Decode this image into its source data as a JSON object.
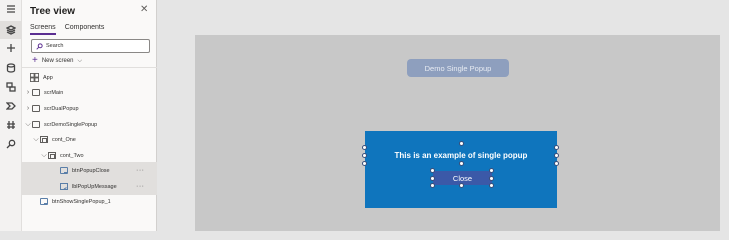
{
  "panel": {
    "title": "Tree view",
    "tabs": [
      {
        "label": "Screens",
        "active": true
      },
      {
        "label": "Components",
        "active": false
      }
    ],
    "search_placeholder": "Search",
    "new_screen_label": "New screen"
  },
  "tree": {
    "app": "App",
    "scrMain": "scrMain",
    "scrDualPopup": "scrDualPopup",
    "scrDemoSinglePopup": "scrDemoSinglePopup",
    "cont_One": "cont_One",
    "cont_Two": "cont_Two",
    "btnPopupClose": "btnPopupClose",
    "lblPopUpMessage": "lblPopUpMessage",
    "btnShowSinglePopup_1": "btnShowSinglePopup_1",
    "more": "···"
  },
  "canvas": {
    "demo_button_label": "Demo Single Popup",
    "popup_message": "This is an example of single popup",
    "popup_close_label": "Close"
  },
  "colors": {
    "accent": "#5b2e91",
    "popup_bg": "#0f75bd",
    "close_btn": "#3b59a8",
    "demo_btn": "#8e9fbe"
  }
}
